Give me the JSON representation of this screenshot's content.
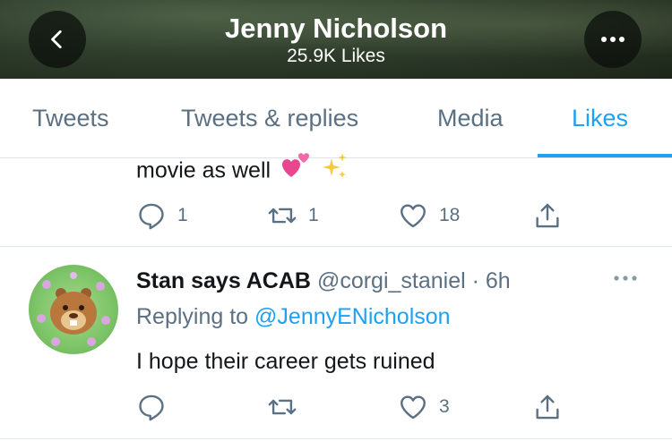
{
  "header": {
    "title": "Jenny Nicholson",
    "subtitle": "25.9K Likes",
    "back_icon": "chevron-left-icon",
    "more_icon": "more-horizontal-icon"
  },
  "tabs": [
    {
      "label": "Tweets",
      "active": false
    },
    {
      "label": "Tweets & replies",
      "active": false
    },
    {
      "label": "Media",
      "active": false
    },
    {
      "label": "Likes",
      "active": true
    }
  ],
  "previous_tweet": {
    "text_fragment": "movie as well",
    "emojis": [
      "two-hearts-icon",
      "sparkles-icon"
    ],
    "reply_count": "1",
    "retweet_count": "1",
    "like_count": "18"
  },
  "tweet": {
    "display_name": "Stan says ACAB",
    "handle": "@corgi_staniel",
    "separator": " · ",
    "time": "6h",
    "replying_prefix": "Replying to ",
    "replying_to": "@JennyENicholson",
    "text": "I hope their career gets ruined",
    "reply_count": "",
    "retweet_count": "",
    "like_count": "3"
  },
  "colors": {
    "accent": "#1da1f2",
    "secondary_text": "#5b7083",
    "primary_text": "#14171a",
    "heart_pink": "#f0509c"
  }
}
